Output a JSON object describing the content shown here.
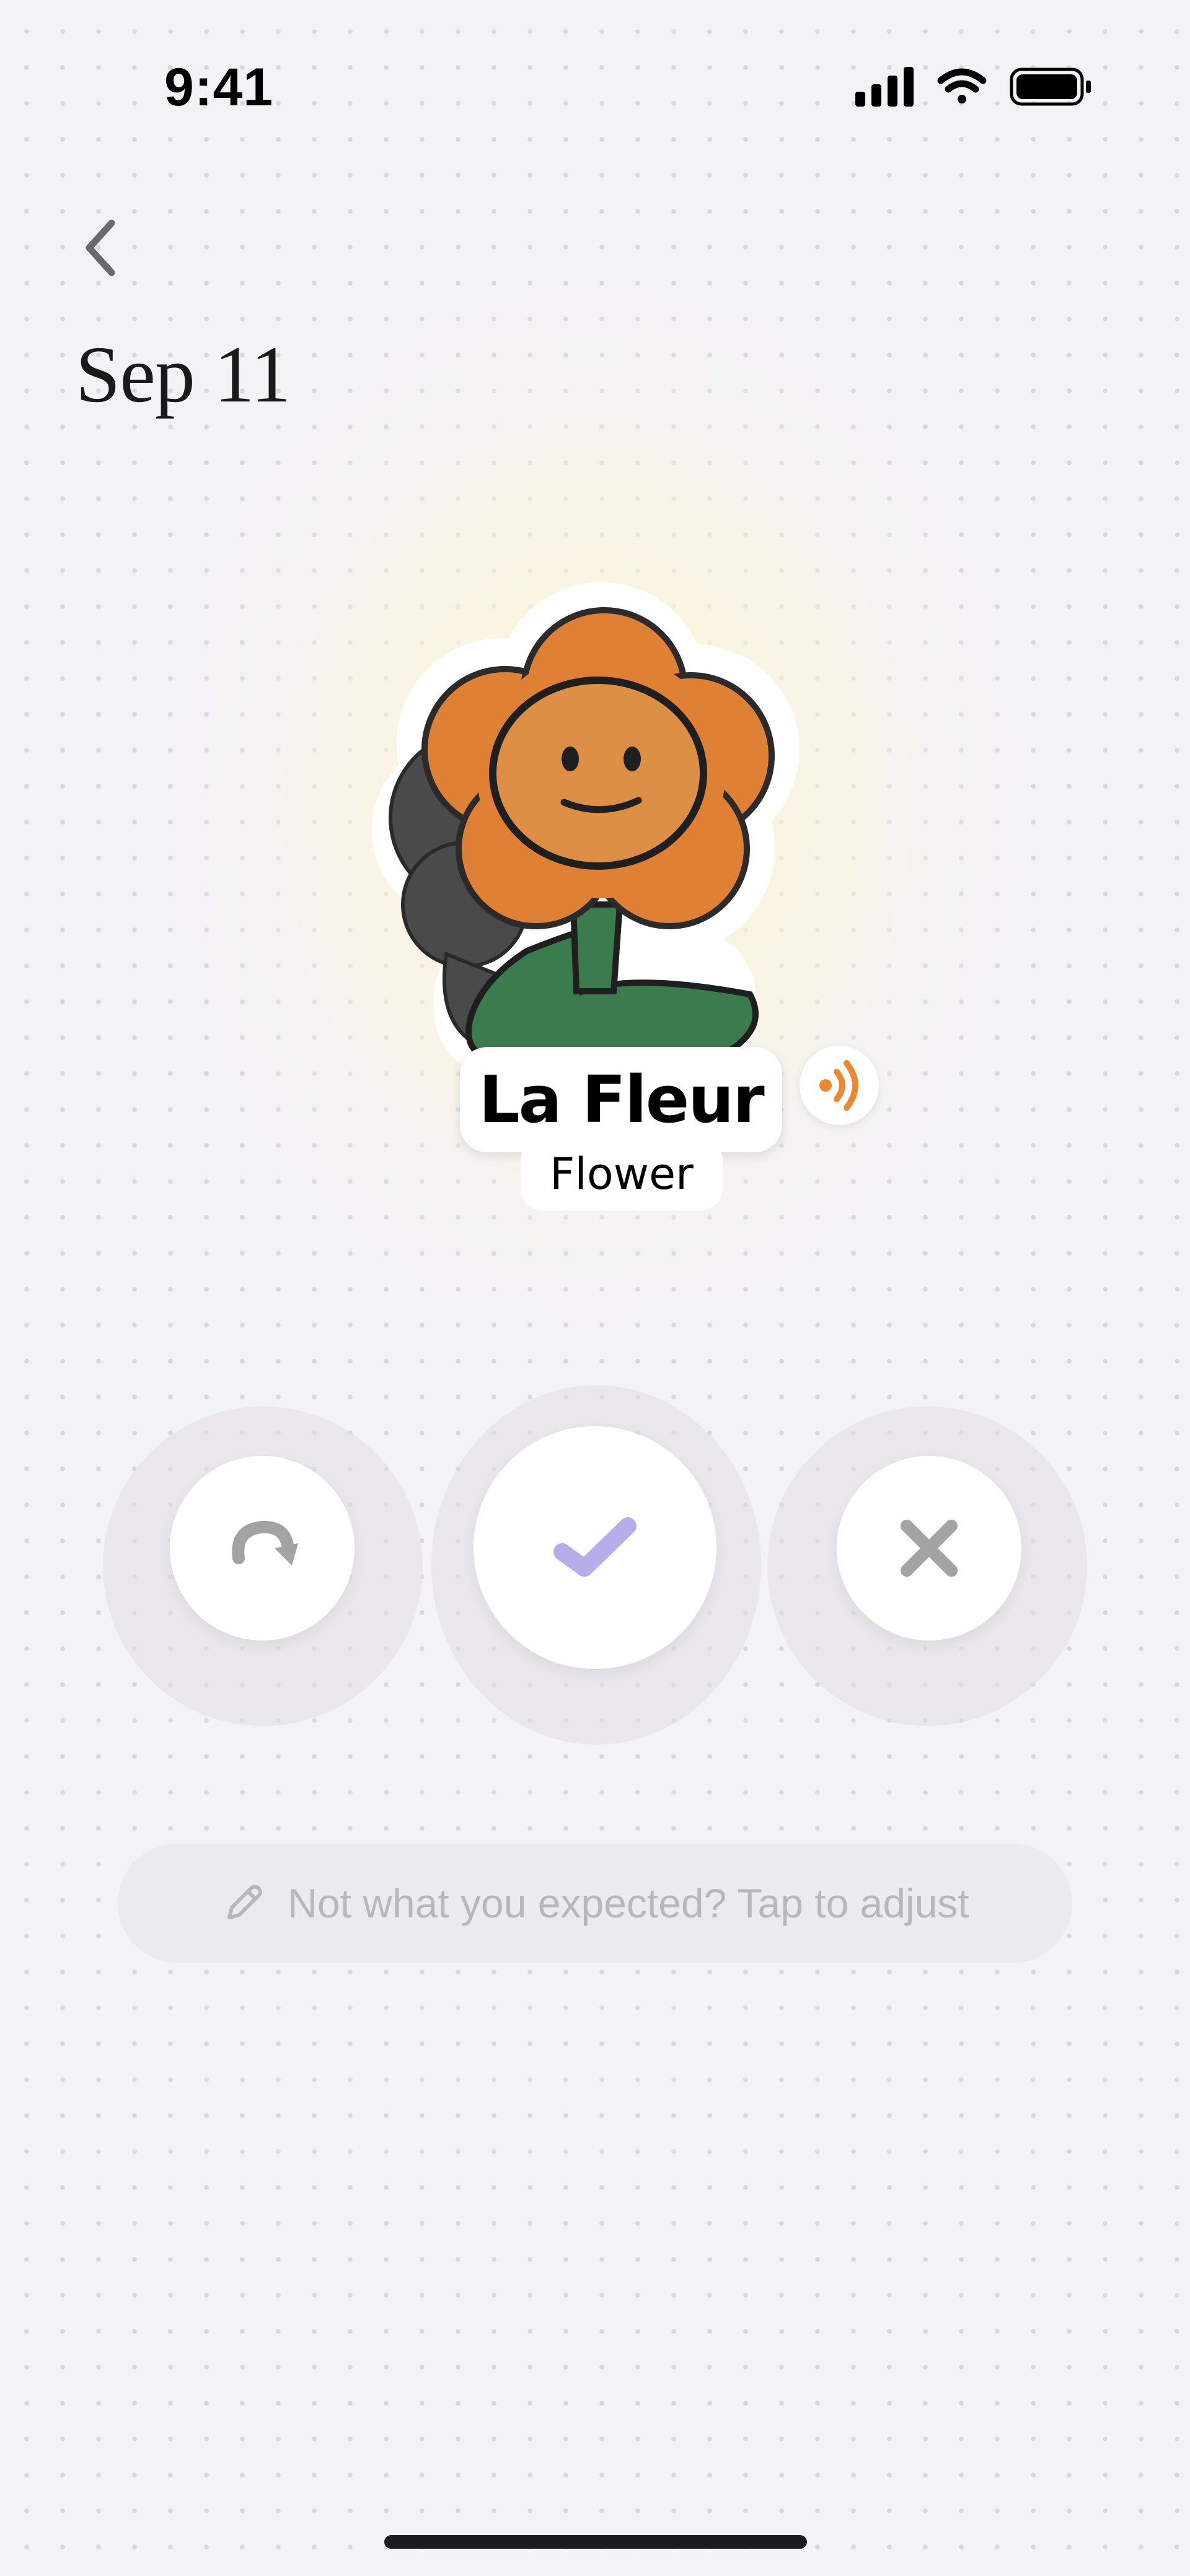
{
  "status_bar": {
    "time": "9:41",
    "cellular_icon": "cellular-signal-icon",
    "wifi_icon": "wifi-icon",
    "battery_icon": "battery-full-icon"
  },
  "header": {
    "back_icon": "chevron-left-icon",
    "title": "Sep 11"
  },
  "card": {
    "image": "flower-sticker",
    "word": "La Fleur",
    "translation": "Flower",
    "audio_icon": "speaker-sound-icon",
    "audio_color": "#e98a33"
  },
  "actions": {
    "retry_icon": "redo-arrow-icon",
    "confirm_icon": "checkmark-icon",
    "confirm_color": "#b6aeea",
    "dismiss_icon": "close-x-icon",
    "icon_color": "#a3a3a3"
  },
  "adjust": {
    "icon": "pencil-icon",
    "label": "Not what you expected? Tap to adjust"
  },
  "colors": {
    "background": "#f3f2f5",
    "petal": "#e08034",
    "face": "#dc8f45",
    "stem": "#3a7c4d"
  }
}
